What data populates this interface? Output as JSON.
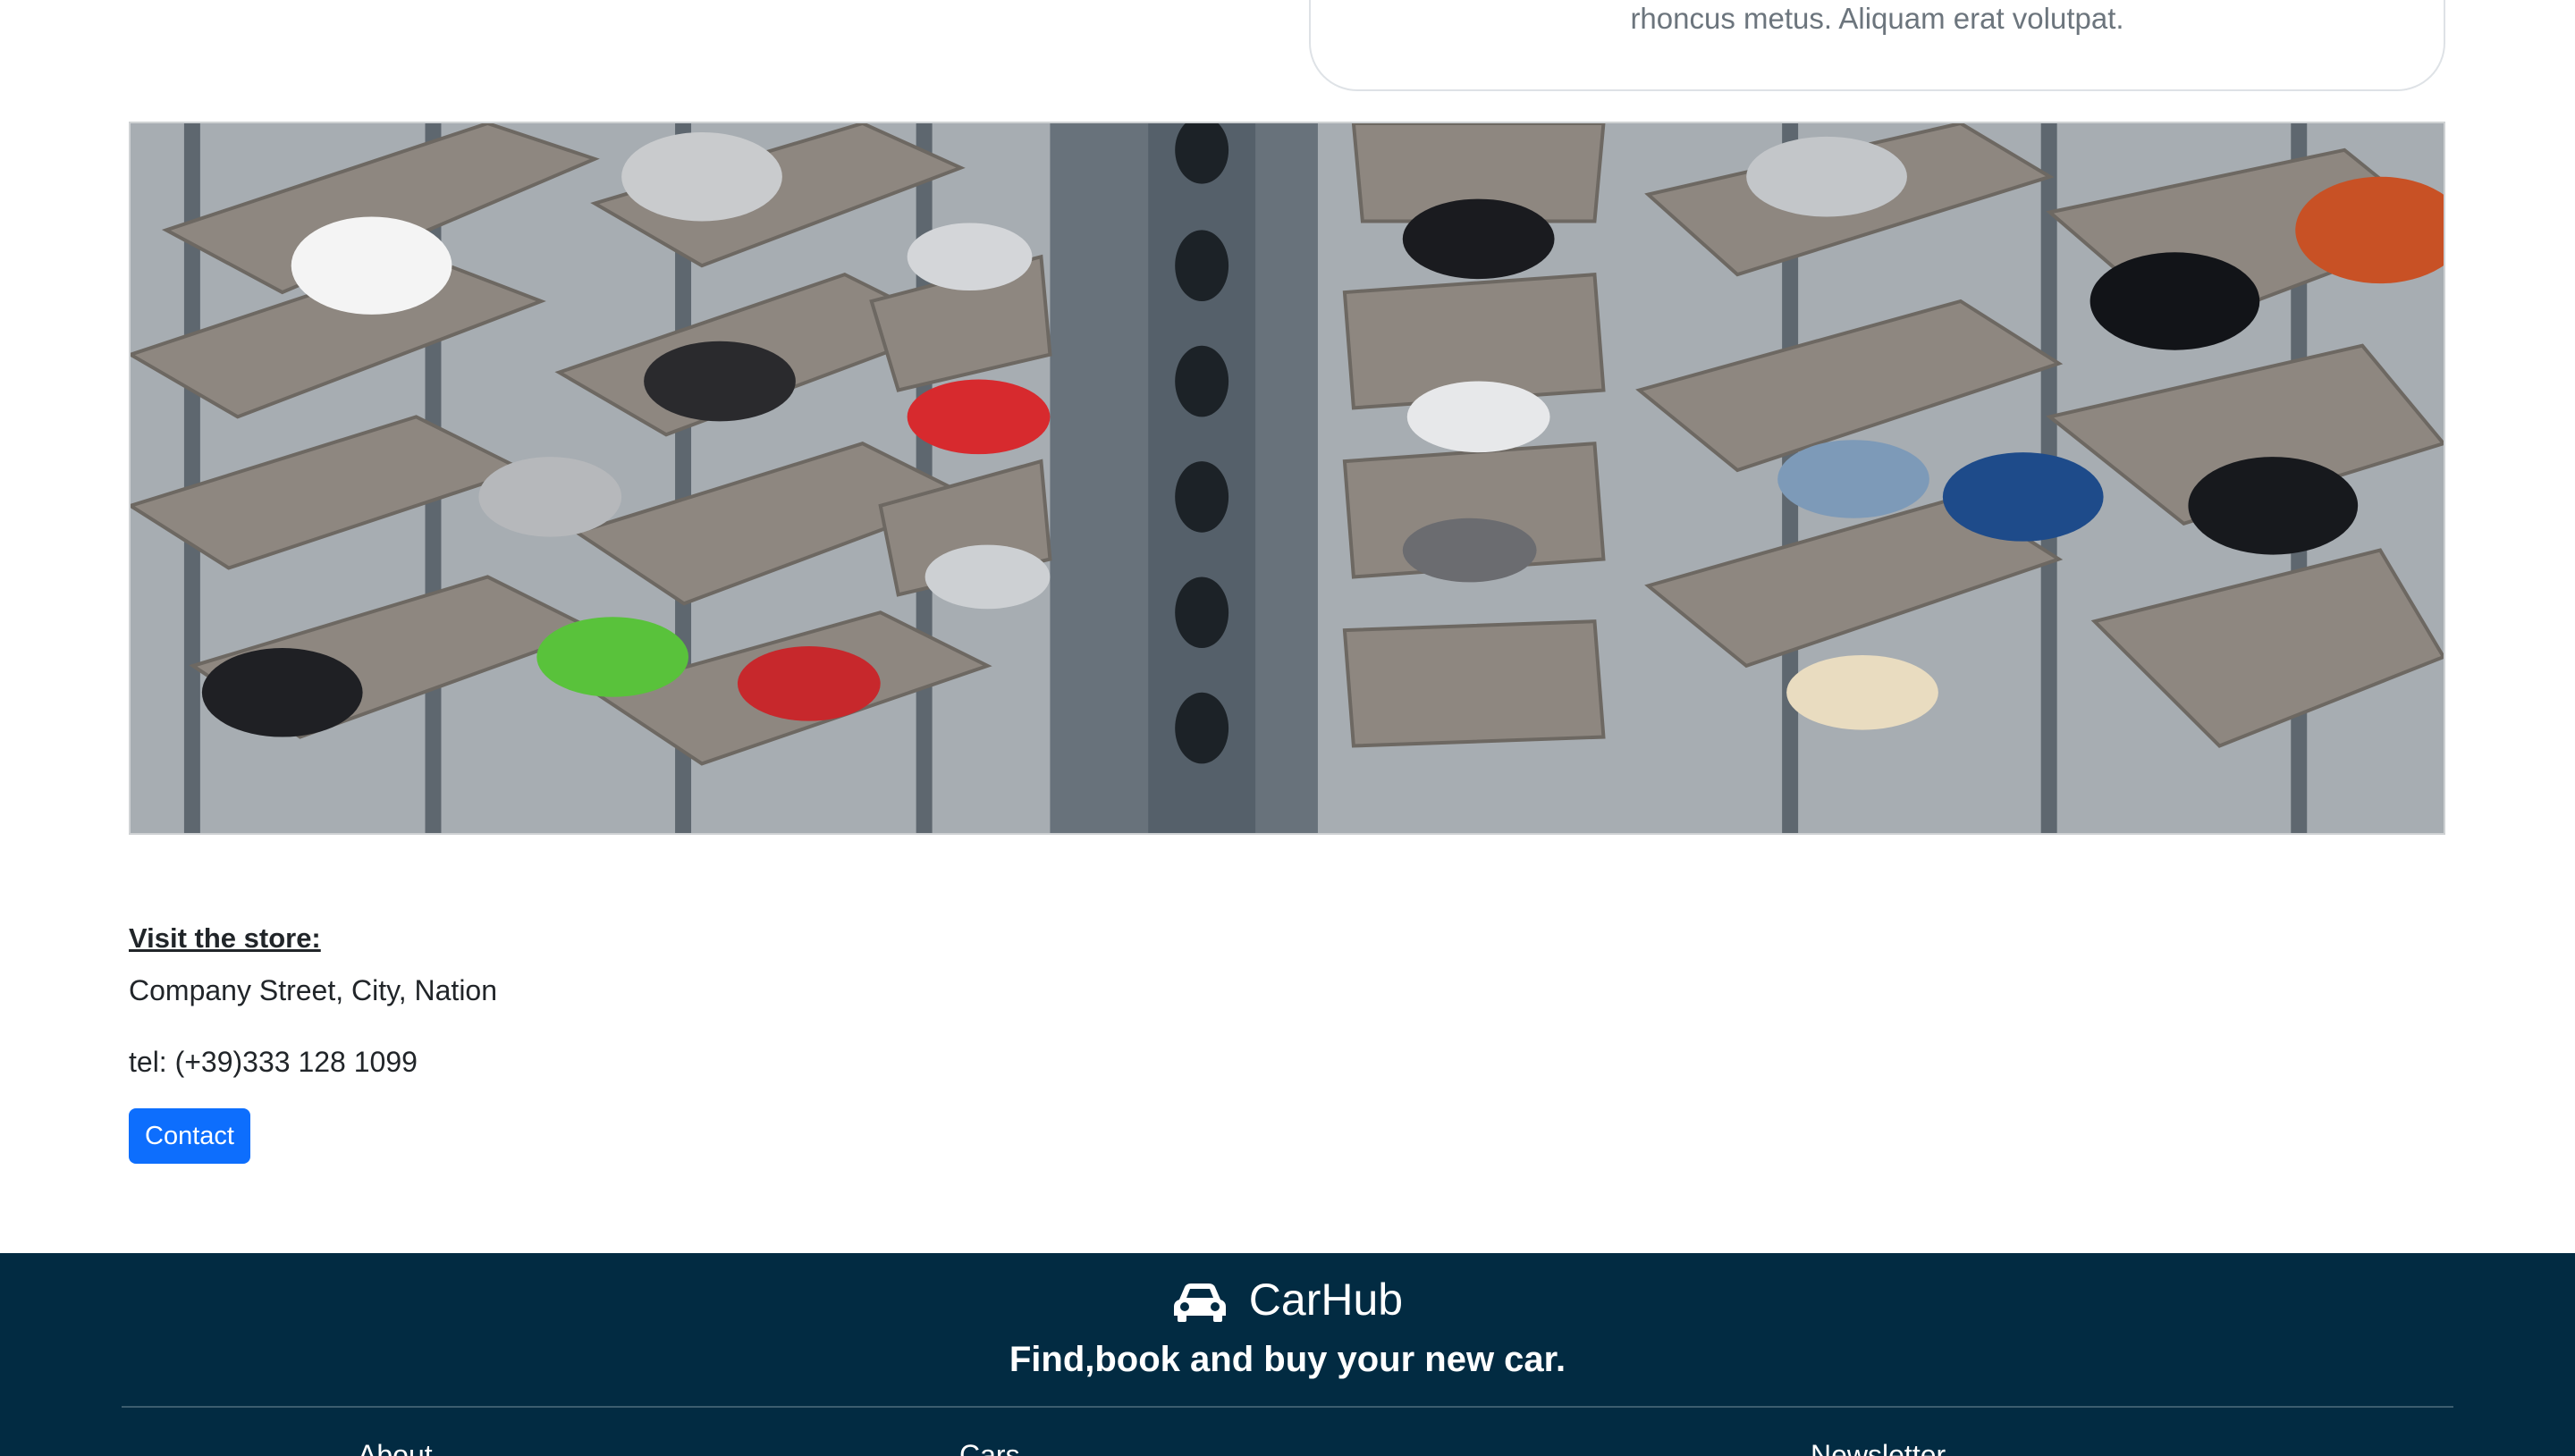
{
  "card": {
    "text": "rhoncus metus. Aliquam erat volutpat."
  },
  "hero": {
    "alt": "Automated car parking tower with vehicles on stacked platforms"
  },
  "store": {
    "heading": "Visit the store:",
    "address": "Company Street, City, Nation",
    "phone": "tel: (+39)333 128 1099",
    "contact_label": "Contact"
  },
  "footer": {
    "brand": "CarHub",
    "icon": "car-icon",
    "tagline": "Find,book and buy your new car.",
    "columns": [
      "About",
      "Cars",
      "Newsletter"
    ]
  },
  "colors": {
    "primary": "#0d6efd",
    "footer_bg": "#022b42"
  }
}
